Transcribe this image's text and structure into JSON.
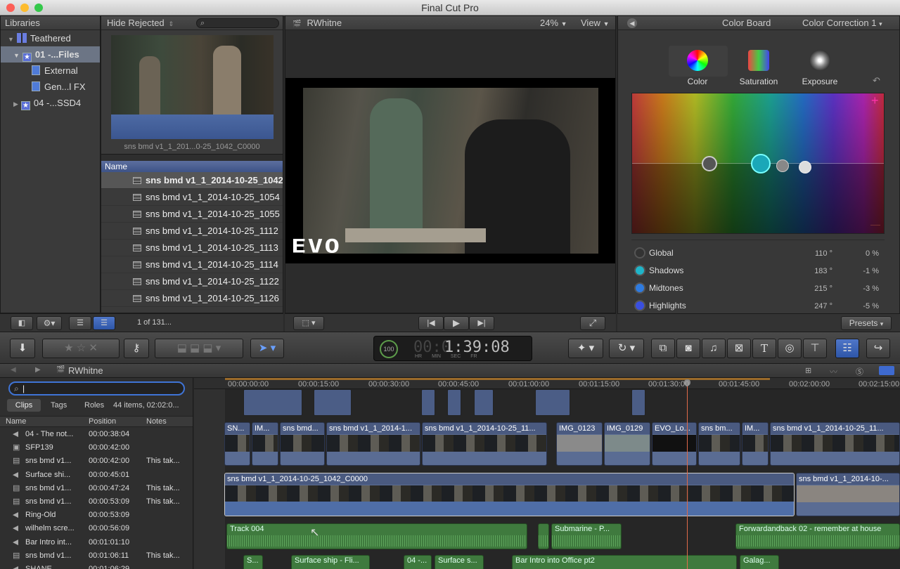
{
  "app": {
    "title": "Final Cut Pro"
  },
  "libraries": {
    "header": "Libraries",
    "filter": "Hide Rejected",
    "items": [
      {
        "label": "Teathered"
      },
      {
        "label": "01 -...Files"
      },
      {
        "label": "External"
      },
      {
        "label": "Gen...l FX"
      },
      {
        "label": "04 -...SSD4"
      }
    ]
  },
  "browser": {
    "preview_caption": "sns bmd v1_1_201...0-25_1042_C0000",
    "column_name": "Name",
    "files": [
      "sns bmd v1_1_2014-10-25_1042",
      "sns bmd v1_1_2014-10-25_1054",
      "sns bmd v1_1_2014-10-25_1055",
      "sns bmd v1_1_2014-10-25_1112",
      "sns bmd v1_1_2014-10-25_1113",
      "sns bmd v1_1_2014-10-25_1114",
      "sns bmd v1_1_2014-10-25_1122",
      "sns bmd v1_1_2014-10-25_1126"
    ],
    "count": "1 of 131..."
  },
  "viewer": {
    "title": "RWhitne",
    "zoom": "24%",
    "view": "View",
    "watermark": "EVO"
  },
  "inspector": {
    "header": "Color Board",
    "correction": "Color Correction 1",
    "tabs": [
      "Color",
      "Saturation",
      "Exposure"
    ],
    "plus": "+",
    "minus": "—",
    "rows": [
      {
        "name": "Global",
        "deg": "110 °",
        "pct": "0 %",
        "color": "#444444"
      },
      {
        "name": "Shadows",
        "deg": "183 °",
        "pct": "-1 %",
        "color": "#1fb5c9"
      },
      {
        "name": "Midtones",
        "deg": "215 °",
        "pct": "-3 %",
        "color": "#2e7be0"
      },
      {
        "name": "Highlights",
        "deg": "247 °",
        "pct": "-5 %",
        "color": "#3a4fe0"
      }
    ],
    "presets": "Presets"
  },
  "toolbar": {
    "timecode": "1:39:08",
    "timecode_ghost": "00:0",
    "tc_labels": [
      "HR",
      "MIN",
      "SEC",
      "FR"
    ],
    "pct": "100",
    "text_tool": "T"
  },
  "timeline_index": {
    "search_value": "|",
    "tabs": [
      "Clips",
      "Tags",
      "Roles"
    ],
    "summary": "44 items, 02:02:0...",
    "columns": [
      "Name",
      "Position",
      "Notes"
    ],
    "rows": [
      {
        "name": "04 - The not...",
        "pos": "00:00:38:04",
        "note": ""
      },
      {
        "name": "SFP139",
        "pos": "00:00:42:00",
        "note": ""
      },
      {
        "name": "sns bmd v1...",
        "pos": "00:00:42:00",
        "note": "This tak..."
      },
      {
        "name": "Surface shi...",
        "pos": "00:00:45:01",
        "note": ""
      },
      {
        "name": "sns bmd v1...",
        "pos": "00:00:47:24",
        "note": "This tak..."
      },
      {
        "name": "sns bmd v1...",
        "pos": "00:00:53:09",
        "note": "This tak..."
      },
      {
        "name": "Ring-Old",
        "pos": "00:00:53:09",
        "note": ""
      },
      {
        "name": "wilhelm scre...",
        "pos": "00:00:56:09",
        "note": ""
      },
      {
        "name": "Bar Intro int...",
        "pos": "00:01:01:10",
        "note": ""
      },
      {
        "name": "sns bmd v1...",
        "pos": "00:01:06:11",
        "note": "This tak..."
      },
      {
        "name": "SHANE",
        "pos": "00:01:06:29",
        "note": ""
      }
    ]
  },
  "timeline": {
    "title": "RWhitne",
    "ruler": [
      "00:00:00:00",
      "00:00:15:00",
      "00:00:30:00",
      "00:00:45:00",
      "00:01:00:00",
      "00:01:15:00",
      "00:01:30:00",
      "00:01:45:00",
      "00:02:00:00",
      "00:02:15:00"
    ],
    "clips_upper": [
      "SN...",
      "IM...",
      "sns bmd...",
      "sns bmd v1_1_2014-1...",
      "sns bmd v1_1_2014-10-25_11...",
      "IMG_0123",
      "IMG_0129",
      "EVO_Lo...",
      "sns bm...",
      "IM...",
      "sns bmd v1_1_2014-10-25_11..."
    ],
    "primary": [
      "sns bmd v1_1_2014-10-25_1042_C0000",
      "sns bmd v1_1_2014-10-..."
    ],
    "audio": [
      "Track 004",
      "Submarine - P...",
      "Forwardandback 02 - remember at house"
    ],
    "audio_lower": [
      "S...",
      "Surface ship - Fli...",
      "04 -...",
      "Surface s...",
      "Bar Intro into Office pt2",
      "Galag..."
    ]
  }
}
